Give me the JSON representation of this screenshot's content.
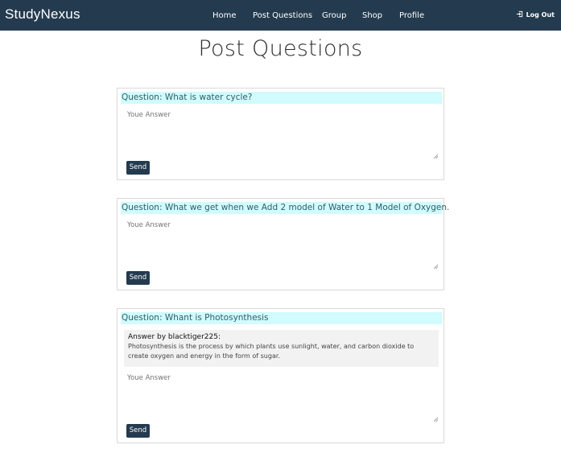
{
  "navbar": {
    "brand": "StudyNexus",
    "links": [
      {
        "label": "Home"
      },
      {
        "label": "Post Questions"
      },
      {
        "label": "Group"
      },
      {
        "label": "Shop"
      },
      {
        "label": "Profile"
      }
    ],
    "logout_label": "Log Out",
    "logout_icon": "logout-icon"
  },
  "page": {
    "title": "Post Questions"
  },
  "questions": [
    {
      "heading": "Question: What is water cycle?",
      "answer_placeholder": "Youe Answer",
      "send_label": "Send"
    },
    {
      "heading": "Question: What we get when we Add 2 model of Water to 1 Model of Oxygen.",
      "answer_placeholder": "Youe Answer",
      "send_label": "Send"
    },
    {
      "heading": "Question: Whant is Photosynthesis",
      "answers": [
        {
          "by": "Answer by blacktiger225:",
          "text": "Photosynthesis is the process by which plants use sunlight, water, and carbon dioxide to create oxygen and energy in the form of sugar."
        }
      ],
      "answer_placeholder": "Youe Answer",
      "send_label": "Send"
    }
  ],
  "colors": {
    "navbar_bg": "#243b4f",
    "question_heading_bg": "#d1fbfd",
    "button_bg": "#243b4f"
  }
}
